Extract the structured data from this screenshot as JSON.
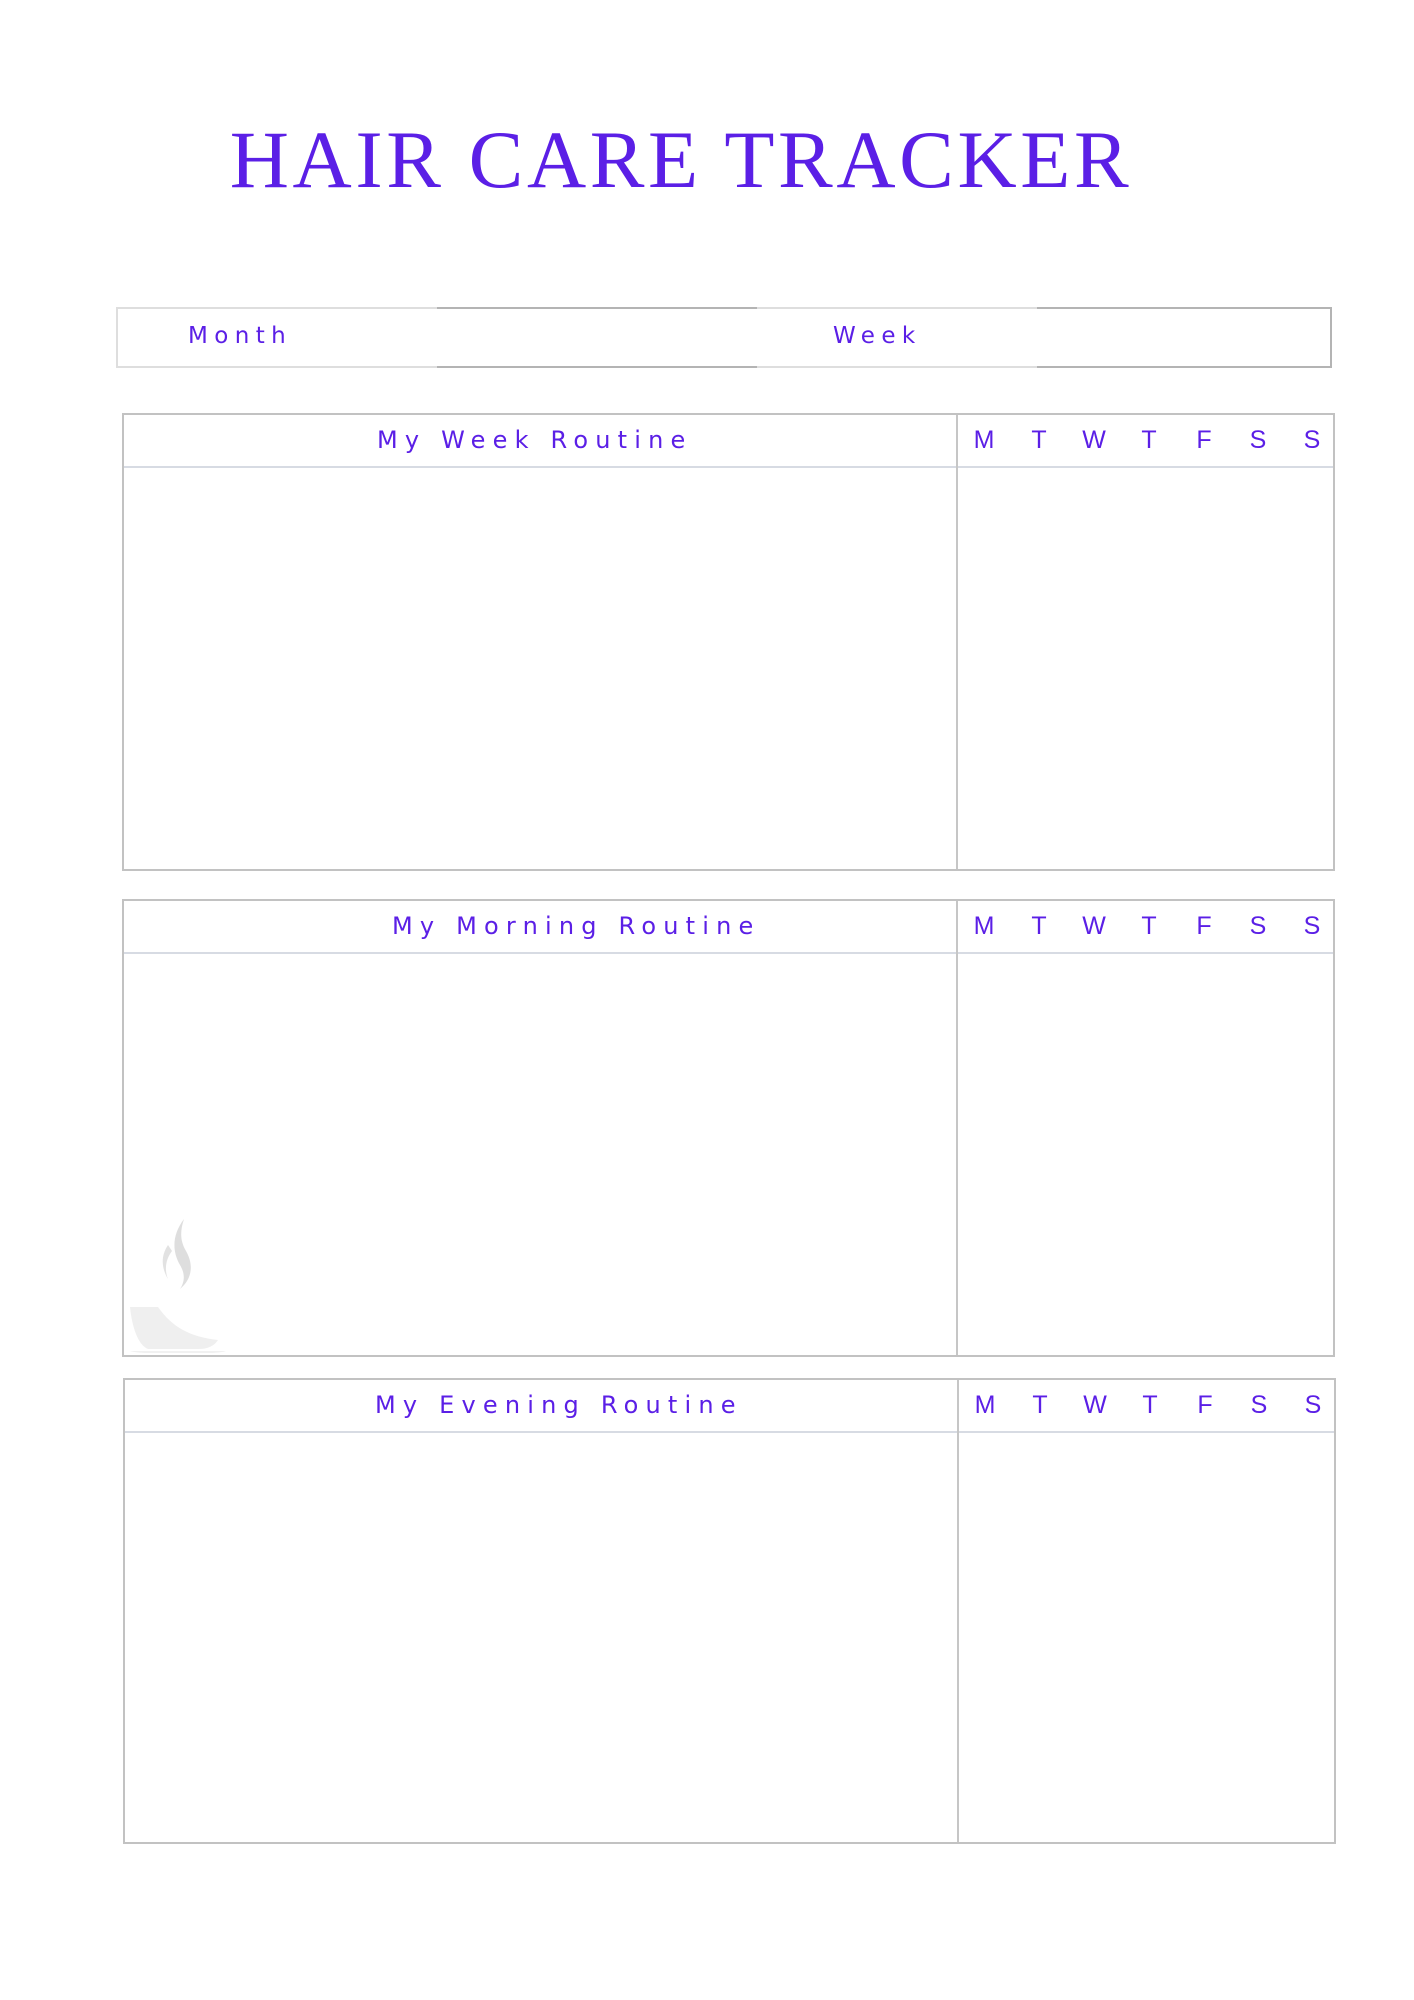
{
  "page": {
    "title": "HAIR CARE TRACKER",
    "accent_color": "#5b1fe6",
    "border_color": "#c2c2c2"
  },
  "period_bar": {
    "month_label": "Month",
    "week_label": "Week"
  },
  "days": [
    "M",
    "T",
    "W",
    "T",
    "F",
    "S",
    "S"
  ],
  "routines": [
    {
      "id": "week",
      "title": "My Week Routine"
    },
    {
      "id": "morning",
      "title": "My Morning Routine",
      "decoration": "coffee-cup-icon"
    },
    {
      "id": "evening",
      "title": "My Evening Routine"
    }
  ]
}
